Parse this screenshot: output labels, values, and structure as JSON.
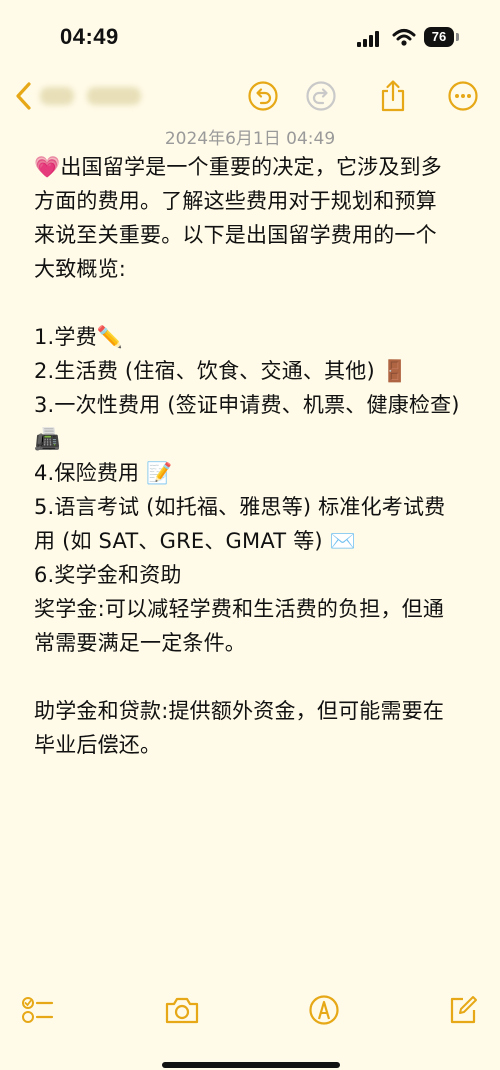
{
  "status_bar": {
    "time": "04:49",
    "battery": "76"
  },
  "toolbar": {
    "back_icon": "chevron-left-icon",
    "undo_icon": "undo-icon",
    "redo_icon": "redo-icon",
    "share_icon": "share-icon",
    "more_icon": "ellipsis-circle-icon",
    "accent": "#e6a817"
  },
  "note": {
    "date": "2024年6月1日 04:49",
    "lines": [
      "💗出国留学是一个重要的决定，它涉及到多",
      "方面的费用。了解这些费用对于规划和预算",
      "来说至关重要。以下是出国留学费用的一个",
      "大致概览:",
      "",
      "1.学费✏️",
      "2.生活费 (住宿、饮食、交通、其他) 🚪",
      "3.一次性费用 (签证申请费、机票、健康检查)",
      "📠",
      "4.保险费用 📝",
      "5.语言考试 (如托福、雅思等) 标准化考试费",
      "用 (如 SAT、GRE、GMAT 等) ✉️",
      "6.奖学金和资助",
      "奖学金:可以减轻学费和生活费的负担，但通",
      "常需要满足一定条件。",
      "",
      "助学金和贷款:提供额外资金，但可能需要在",
      "毕业后偿还。"
    ]
  },
  "bottom_bar": {
    "checklist_icon": "checklist-icon",
    "camera_icon": "camera-icon",
    "markup_icon": "markup-pen-icon",
    "compose_icon": "compose-icon"
  }
}
